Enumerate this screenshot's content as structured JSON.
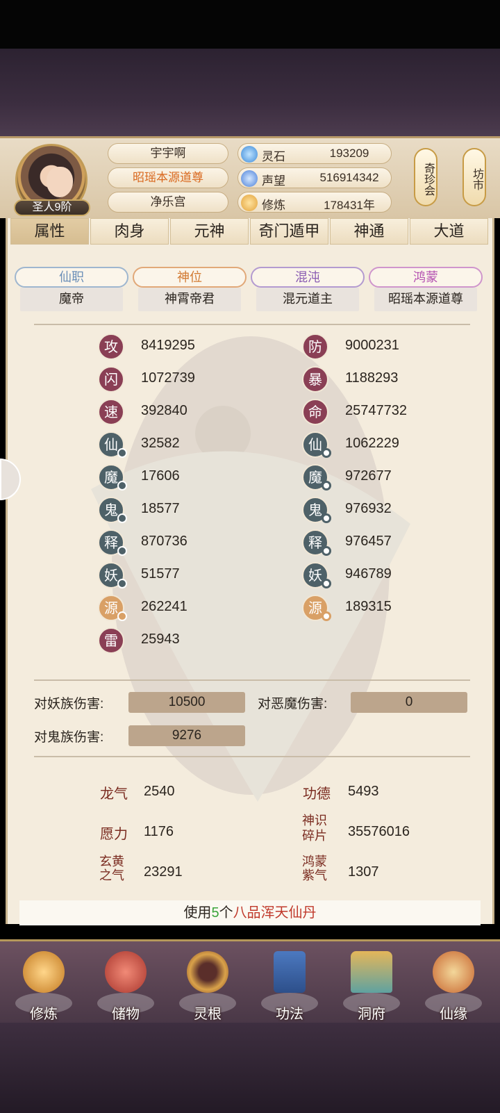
{
  "header": {
    "player_name": "宇宇啊",
    "title": "昭瑶本源道尊",
    "sect": "净乐宫",
    "rank": "圣人9阶",
    "resources": [
      {
        "label": "灵石",
        "value": "193209",
        "icon": "spirit-stone-icon",
        "color": "#5aa7e8"
      },
      {
        "label": "声望",
        "value": "516914342",
        "icon": "prestige-crystal-icon",
        "color": "#4a7fd8"
      },
      {
        "label": "修炼",
        "value": "178431年",
        "icon": "meditation-icon",
        "color": "#e2a23a"
      }
    ],
    "side_buttons": [
      "奇珍会",
      "坊市"
    ]
  },
  "tabs": [
    "属性",
    "肉身",
    "元神",
    "奇门遁甲",
    "神通",
    "大道"
  ],
  "ranks": [
    {
      "label": "仙职",
      "value": "魔帝",
      "color": "#6b8fb8"
    },
    {
      "label": "神位",
      "value": "神霄帝君",
      "color": "#d27a32"
    },
    {
      "label": "混沌",
      "value": "混元道主",
      "color": "#8a5cb2"
    },
    {
      "label": "鸿蒙",
      "value": "昭瑶本源道尊",
      "color": "#b34fb0"
    }
  ],
  "stats_left": [
    {
      "label": "攻",
      "value": "8419295"
    },
    {
      "label": "闪",
      "value": "1072739"
    },
    {
      "label": "速",
      "value": "392840"
    },
    {
      "label": "仙",
      "value": "32582"
    },
    {
      "label": "魔",
      "value": "17606"
    },
    {
      "label": "鬼",
      "value": "18577"
    },
    {
      "label": "释",
      "value": "870736"
    },
    {
      "label": "妖",
      "value": "51577"
    },
    {
      "label": "源",
      "value": "262241"
    },
    {
      "label": "雷",
      "value": "25943"
    }
  ],
  "stats_right": [
    {
      "label": "防",
      "value": "9000231"
    },
    {
      "label": "暴",
      "value": "1188293"
    },
    {
      "label": "命",
      "value": "25747732"
    },
    {
      "label": "仙",
      "value": "1062229"
    },
    {
      "label": "魔",
      "value": "972677"
    },
    {
      "label": "鬼",
      "value": "976932"
    },
    {
      "label": "释",
      "value": "976457"
    },
    {
      "label": "妖",
      "value": "946789"
    },
    {
      "label": "源",
      "value": "189315"
    }
  ],
  "damage": {
    "demon_race_label": "对妖族伤害:",
    "demon_race_value": "10500",
    "evil_label": "对恶魔伤害:",
    "evil_value": "0",
    "ghost_label": "对鬼族伤害:",
    "ghost_value": "9276"
  },
  "misc": [
    {
      "label": "龙气",
      "value": "2540"
    },
    {
      "label": "功德",
      "value": "5493"
    },
    {
      "label": "愿力",
      "value": "1176"
    },
    {
      "label": "神识碎片",
      "value": "35576016"
    },
    {
      "label": "玄黄之气",
      "value": "23291"
    },
    {
      "label": "鸿蒙紫气",
      "value": "1307"
    }
  ],
  "use_bar": {
    "prefix": "使用",
    "count": "5",
    "middle": "个",
    "item": "八品浑天仙丹"
  },
  "nav": [
    "修炼",
    "储物",
    "灵根",
    "功法",
    "洞府",
    "仙缘"
  ]
}
